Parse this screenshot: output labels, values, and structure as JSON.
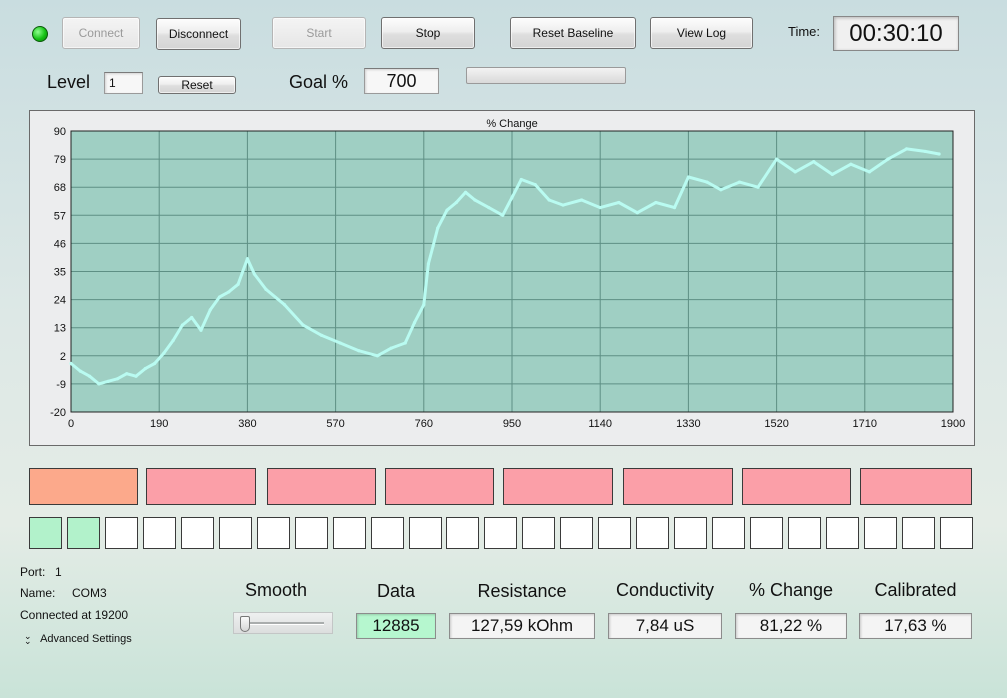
{
  "toolbar": {
    "connect_label": "Connect",
    "disconnect_label": "Disconnect",
    "start_label": "Start",
    "stop_label": "Stop",
    "reset_baseline_label": "Reset Baseline",
    "view_log_label": "View Log",
    "time_label": "Time:",
    "time_value": "00:30:10",
    "status_color": "#16c216"
  },
  "level": {
    "label": "Level",
    "value": "1",
    "reset_label": "Reset"
  },
  "goal": {
    "label": "Goal %",
    "value": "700",
    "progress_fraction": 0
  },
  "chart_data": {
    "type": "line",
    "title": "% Change",
    "xlabel": "",
    "ylabel": "",
    "xlim": [
      0,
      1900
    ],
    "ylim": [
      -20,
      90
    ],
    "x_ticks": [
      0,
      190,
      380,
      570,
      760,
      950,
      1140,
      1330,
      1520,
      1710,
      1900
    ],
    "y_ticks": [
      90,
      79,
      68,
      57,
      46,
      35,
      24,
      13,
      2,
      -9,
      -20
    ],
    "grid": true,
    "line_color": "#b9fbf1",
    "plot_background": "#9fcfc3",
    "series": [
      {
        "x": [
          0,
          20,
          40,
          60,
          80,
          100,
          120,
          140,
          160,
          180,
          200,
          220,
          240,
          260,
          280,
          300,
          320,
          340,
          360,
          380,
          395,
          420,
          460,
          500,
          540,
          580,
          620,
          660,
          690,
          720,
          740,
          760,
          770,
          780,
          790,
          810,
          830,
          850,
          870,
          900,
          930,
          950,
          970,
          1000,
          1030,
          1060,
          1100,
          1140,
          1180,
          1220,
          1260,
          1300,
          1330,
          1370,
          1400,
          1440,
          1480,
          1520,
          1560,
          1600,
          1640,
          1680,
          1720,
          1760,
          1800,
          1840,
          1870
        ],
        "y": [
          -1,
          -4,
          -6,
          -9,
          -8,
          -7,
          -5,
          -6,
          -3,
          -1,
          3,
          8,
          14,
          17,
          12,
          20,
          25,
          27,
          30,
          40,
          34,
          28,
          22,
          14,
          10,
          7,
          4,
          2,
          5,
          7,
          15,
          22,
          38,
          45,
          52,
          59,
          62,
          66,
          63,
          60,
          57,
          64,
          71,
          69,
          63,
          61,
          63,
          60,
          62,
          58,
          62,
          60,
          72,
          70,
          67,
          70,
          68,
          79,
          74,
          78,
          73,
          77,
          74,
          79,
          83,
          82,
          81
        ]
      }
    ]
  },
  "indicators": {
    "big_colors": [
      "#fca98b",
      "#fb9fa8",
      "#fb9fa8",
      "#fb9fa8",
      "#fb9fa8",
      "#fb9fa8",
      "#fb9fa8",
      "#fb9fa8"
    ],
    "small_active_count": 2,
    "small_total": 25,
    "active_color": "#b2f2cb"
  },
  "connection": {
    "port_label": "Port:",
    "port_value": "1",
    "name_label": "Name:",
    "name_value": "COM3",
    "status_text": "Connected at 19200",
    "advanced_label": "Advanced Settings"
  },
  "metrics": {
    "smooth_label": "Smooth",
    "smooth_level": 0,
    "data_label": "Data",
    "data_value": "12885",
    "data_color": "#b6f7cf",
    "resistance_label": "Resistance",
    "resistance_value": "127,59 kOhm",
    "conductivity_label": "Conductivity",
    "conductivity_value": "7,84 uS",
    "change_label": "% Change",
    "change_value": "81,22 %",
    "calibrated_label": "Calibrated",
    "calibrated_value": "17,63 %"
  }
}
